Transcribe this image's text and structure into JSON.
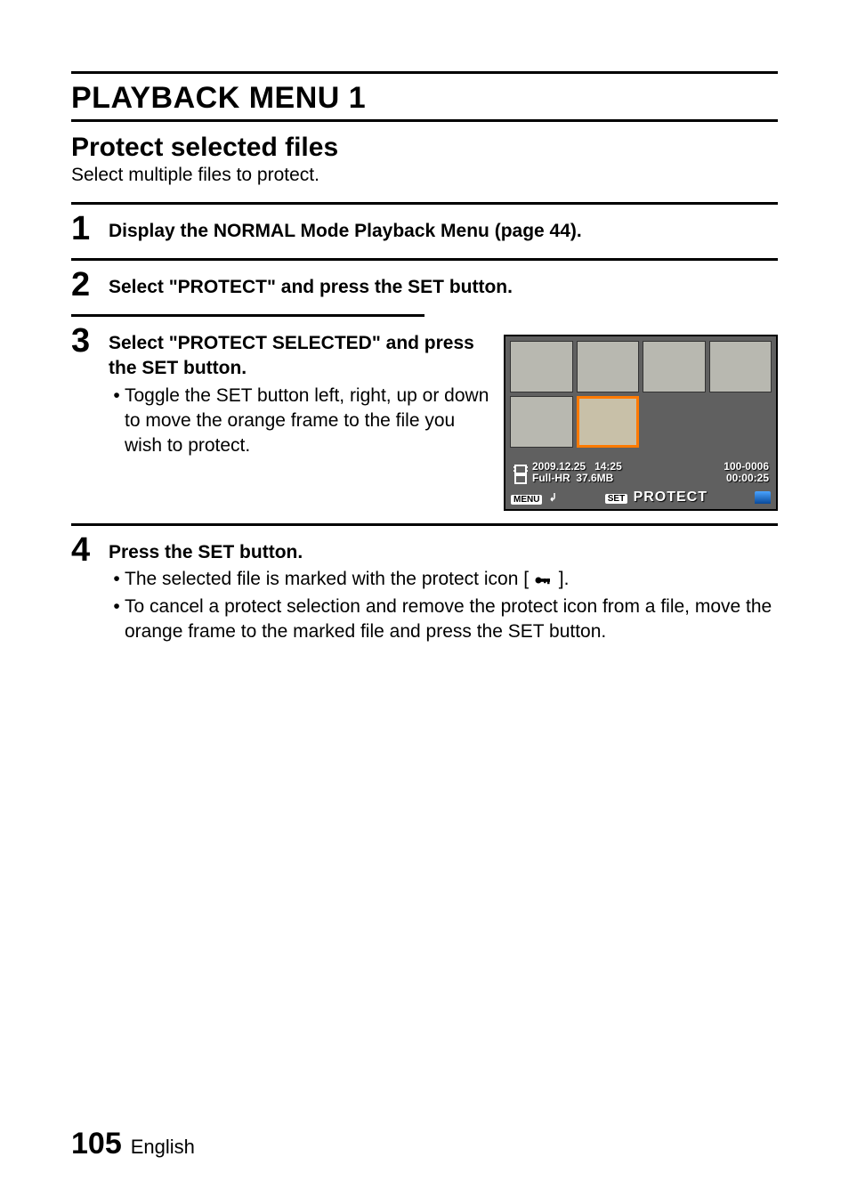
{
  "page_title": "PLAYBACK MENU 1",
  "subheading": "Protect selected files",
  "subdesc": "Select multiple files to protect.",
  "steps": {
    "s1": {
      "num": "1",
      "bold": "Display the NORMAL Mode Playback Menu (page 44)."
    },
    "s2": {
      "num": "2",
      "bold": "Select \"PROTECT\" and press the SET button."
    },
    "s3": {
      "num": "3",
      "bold": "Select \"PROTECT SELECTED\" and press the SET button.",
      "bullet1": "Toggle the SET button left, right, up or down to move the orange frame to the file you wish to protect."
    },
    "s4": {
      "num": "4",
      "bold": "Press the SET button.",
      "bullet1_pre": "The selected file is marked with the protect icon [",
      "bullet1_post": "].",
      "bullet2": "To cancel a protect selection and remove the protect icon from a file, move the orange frame to the marked file and press the SET button."
    }
  },
  "screenshot": {
    "date": "2009.12.25",
    "time": "14:25",
    "quality": "Full-HR",
    "size": "37.6MB",
    "file_number": "100-0006",
    "duration": "00:00:25",
    "menu_label": "MENU",
    "set_label": "SET",
    "action_label": "PROTECT"
  },
  "footer": {
    "page": "105",
    "lang": "English"
  }
}
